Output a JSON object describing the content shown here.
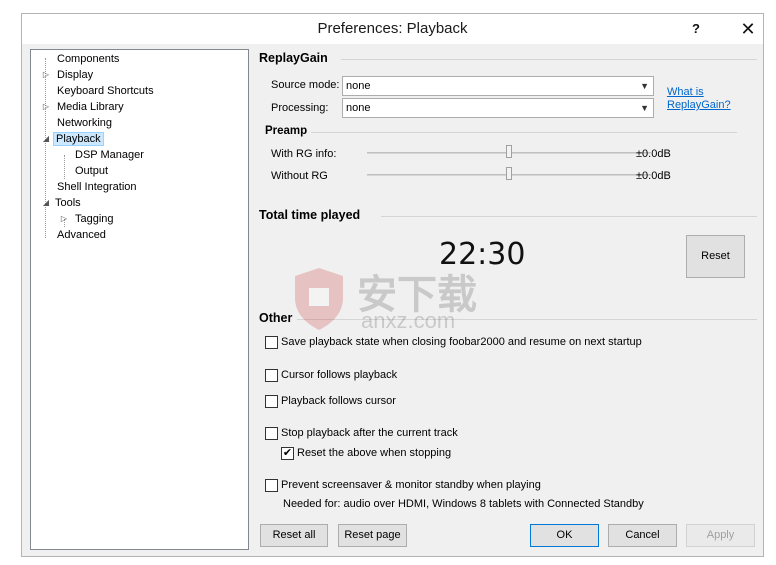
{
  "window": {
    "title": "Preferences: Playback",
    "help_label": "?",
    "close_label": "✕"
  },
  "tree": {
    "items": [
      {
        "label": "Components",
        "expander": ""
      },
      {
        "label": "Display",
        "expander": "▷"
      },
      {
        "label": "Keyboard Shortcuts",
        "expander": ""
      },
      {
        "label": "Media Library",
        "expander": "▷"
      },
      {
        "label": "Networking",
        "expander": ""
      },
      {
        "label": "Playback",
        "expander": "◢",
        "selected": true
      },
      {
        "label": "DSP Manager",
        "expander": ""
      },
      {
        "label": "Output",
        "expander": ""
      },
      {
        "label": "Shell Integration",
        "expander": ""
      },
      {
        "label": "Tools",
        "expander": "◢"
      },
      {
        "label": "Tagging",
        "expander": "▷"
      },
      {
        "label": "Advanced",
        "expander": ""
      }
    ]
  },
  "replaygain": {
    "title": "ReplayGain",
    "source_mode_label": "Source mode:",
    "source_mode_value": "none",
    "processing_label": "Processing:",
    "processing_value": "none",
    "help_link": "What is ReplayGain?",
    "preamp_title": "Preamp",
    "with_rg_label": "With RG info:",
    "with_rg_value": "±0.0dB",
    "with_rg_level": 0.5,
    "without_rg_label": "Without RG",
    "without_rg_value": "±0.0dB",
    "without_rg_level": 0.5
  },
  "total_time": {
    "title": "Total time played",
    "value": "22:30",
    "reset_label": "Reset"
  },
  "other": {
    "title": "Other",
    "options": [
      {
        "label": "Save playback state when closing foobar2000 and resume on next startup",
        "checked": false
      },
      {
        "label": "Cursor follows playback",
        "checked": false
      },
      {
        "label": "Playback follows cursor",
        "checked": false
      },
      {
        "label": "Stop playback after the current track",
        "checked": false
      },
      {
        "label": "Reset the above when stopping",
        "checked": true
      },
      {
        "label": "Prevent screensaver & monitor standby when playing",
        "checked": false
      }
    ],
    "note": "Needed for: audio over HDMI, Windows 8 tablets with Connected Standby"
  },
  "footer": {
    "reset_all": "Reset all",
    "reset_page": "Reset page",
    "ok": "OK",
    "cancel": "Cancel",
    "apply": "Apply"
  },
  "watermark": {
    "text": "安下载",
    "subtext": "anxz.com"
  },
  "colors": {
    "accent": "#0078d7",
    "selection": "#cce8ff",
    "link": "#0066cc"
  }
}
